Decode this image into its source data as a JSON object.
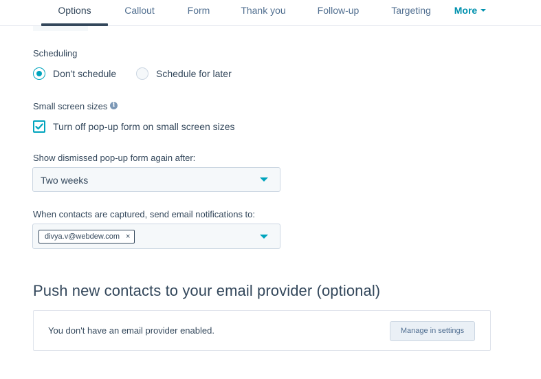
{
  "tabs": [
    {
      "label": "Options",
      "active": true
    },
    {
      "label": "Callout",
      "active": false
    },
    {
      "label": "Form",
      "active": false
    },
    {
      "label": "Thank you",
      "active": false
    },
    {
      "label": "Follow-up",
      "active": false
    },
    {
      "label": "Targeting",
      "active": false
    }
  ],
  "more_label": "More",
  "scheduling": {
    "label": "Scheduling",
    "options": [
      {
        "label": "Don't schedule",
        "selected": true
      },
      {
        "label": "Schedule for later",
        "selected": false
      }
    ]
  },
  "small_screen": {
    "label": "Small screen sizes",
    "info_icon_glyph": "i",
    "checkbox_label": "Turn off pop-up form on small screen sizes",
    "checked": true
  },
  "dismissed": {
    "label": "Show dismissed pop-up form again after:",
    "selected_value": "Two weeks"
  },
  "notifications": {
    "label": "When contacts are captured, send email notifications to:",
    "recipients": [
      "divya.v@webdew.com"
    ],
    "remove_glyph": "×"
  },
  "email_provider": {
    "heading": "Push new contacts to your email provider (optional)",
    "message": "You don't have an email provider enabled.",
    "button_label": "Manage in settings"
  },
  "colors": {
    "accent": "#00a4bd",
    "text": "#33475b",
    "link": "#0091ae",
    "border": "#cbd6e2",
    "input_bg": "#f5f8fa"
  }
}
